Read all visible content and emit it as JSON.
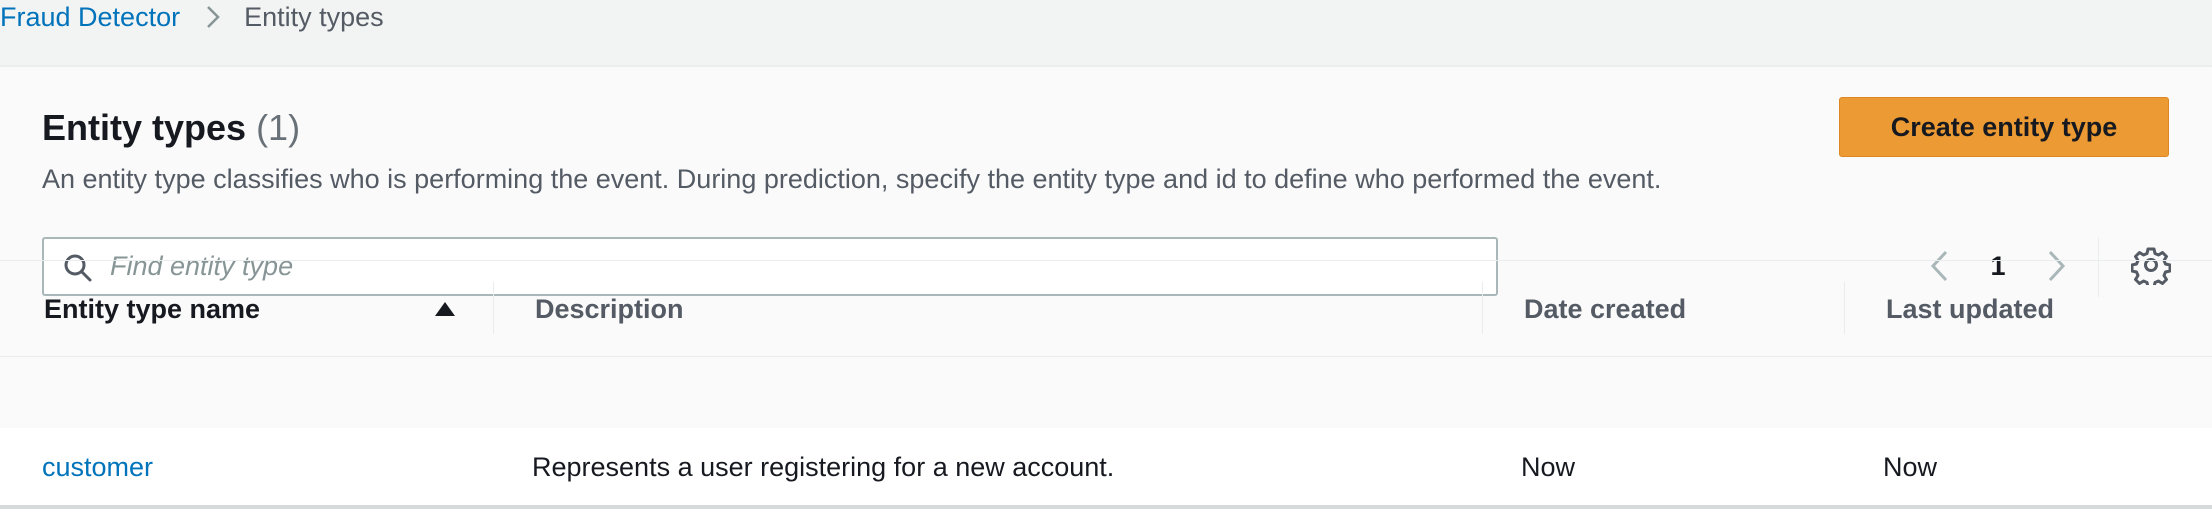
{
  "breadcrumb": {
    "root": "Fraud Detector",
    "current": "Entity types"
  },
  "header": {
    "title": "Entity types",
    "count": "(1)",
    "description": "An entity type classifies who is performing the event. During prediction, specify the entity type and id to define who performed the event.",
    "create_button": "Create entity type"
  },
  "search": {
    "placeholder": "Find entity type",
    "value": ""
  },
  "pagination": {
    "current_page": "1"
  },
  "table": {
    "columns": [
      "Entity type name",
      "Description",
      "Date created",
      "Last updated"
    ],
    "sort_column": "Entity type name",
    "sort_direction": "ascending",
    "rows": [
      {
        "name": "customer",
        "description": "Represents a user registering for a new account.",
        "date_created": "Now",
        "last_updated": "Now"
      }
    ]
  },
  "colors": {
    "primary_button": "#ec9a33",
    "link": "#0073bb"
  },
  "icons": {
    "breadcrumb_separator": "chevron-right-icon",
    "search": "search-icon",
    "previous_page": "chevron-left-icon",
    "next_page": "chevron-right-icon",
    "settings": "gear-icon",
    "sort": "sort-ascending-icon"
  }
}
